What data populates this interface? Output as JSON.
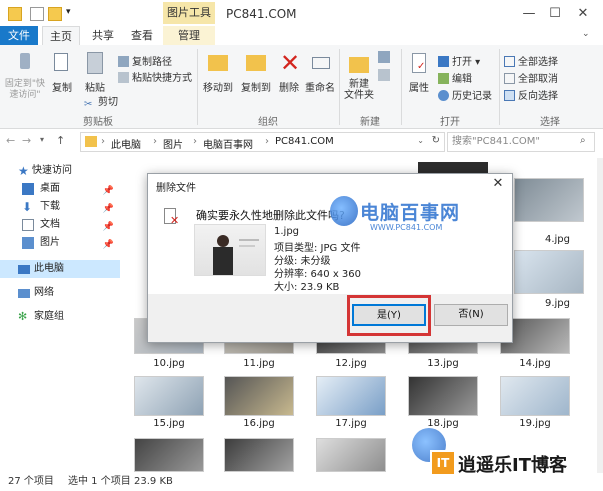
{
  "window": {
    "title": "PC841.COM",
    "context_tab": "图片工具",
    "minimize": "—",
    "maximize": "☐",
    "close": "✕"
  },
  "tabs": {
    "file": "文件",
    "home": "主页",
    "share": "共享",
    "view": "查看",
    "manage": "管理"
  },
  "ribbon": {
    "pin_quick": "固定到\"快速访问\"",
    "copy": "复制",
    "paste": "粘贴",
    "copy_path": "复制路径",
    "paste_shortcut": "粘贴快捷方式",
    "cut": "剪切",
    "clipboard_label": "剪贴板",
    "move_to": "移动到",
    "copy_to": "复制到",
    "delete": "删除",
    "rename": "重命名",
    "organize_label": "组织",
    "new_folder": "新建\n文件夹",
    "new_label": "新建",
    "properties": "属性",
    "open": "打开",
    "edit": "编辑",
    "history": "历史记录",
    "open_label": "打开",
    "select_all": "全部选择",
    "select_none": "全部取消",
    "invert_select": "反向选择",
    "select_label": "选择"
  },
  "address": {
    "crumbs": [
      "此电脑",
      "图片",
      "电脑百事网",
      "PC841.COM"
    ],
    "search_placeholder": "搜索\"PC841.COM\""
  },
  "nav": {
    "quick_access": "快速访问",
    "items": [
      "桌面",
      "下载",
      "文档",
      "图片"
    ],
    "this_pc": "此电脑",
    "network": "网络",
    "homegroup": "家庭组"
  },
  "files": {
    "row1": [
      "4.jpg"
    ],
    "row2": [
      "9.jpg"
    ],
    "row3": [
      "10.jpg",
      "11.jpg",
      "12.jpg",
      "13.jpg",
      "14.jpg"
    ],
    "row4": [
      "15.jpg",
      "16.jpg",
      "17.jpg",
      "18.jpg",
      "19.jpg"
    ]
  },
  "status": {
    "count": "27 个项目",
    "selected": "选中 1 个项目",
    "size": "23.9 KB"
  },
  "dialog": {
    "title": "删除文件",
    "question": "确实要永久性地删除此文件吗?",
    "file_name": "1.jpg",
    "file_type": "项目类型: JPG 文件",
    "rating": "分级: 未分级",
    "resolution": "分辨率: 640 x 360",
    "size": "大小: 23.9 KB",
    "yes": "是(Y)",
    "no": "否(N)"
  },
  "watermark": {
    "site_name": "电脑百事网",
    "site_url": "WWW.PC841.COM",
    "footer_brand": "逍遥乐IT博客"
  },
  "colors": {
    "accent": "#1979ca",
    "highlight_red": "#d43535",
    "context_tab": "#f6e6a9"
  }
}
